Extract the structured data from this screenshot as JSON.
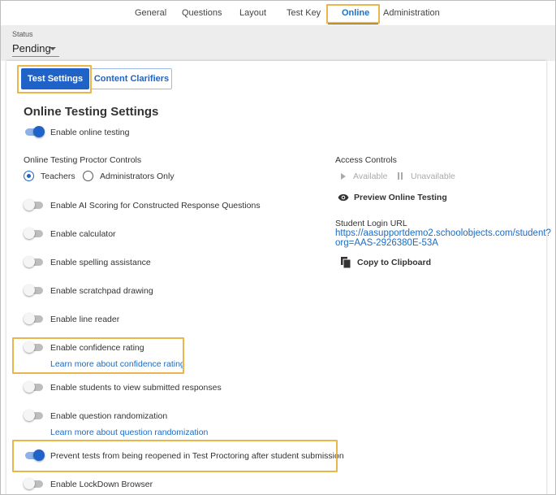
{
  "tabs": [
    {
      "label": "General"
    },
    {
      "label": "Questions"
    },
    {
      "label": "Layout"
    },
    {
      "label": "Test Key"
    },
    {
      "label": "Online"
    },
    {
      "label": "Administration"
    }
  ],
  "status": {
    "label": "Status",
    "value": "Pending"
  },
  "subtabs": {
    "test_settings": "Test Settings",
    "content_clarifiers": "Content Clarifiers"
  },
  "section_title": "Online Testing Settings",
  "enable_online": {
    "label": "Enable online testing",
    "on": true
  },
  "proctor": {
    "label": "Online Testing Proctor Controls",
    "options": [
      {
        "label": "Teachers",
        "checked": true
      },
      {
        "label": "Administrators Only",
        "checked": false
      }
    ]
  },
  "settings": [
    {
      "label": "Enable AI Scoring for Constructed Response Questions",
      "on": false
    },
    {
      "label": "Enable calculator",
      "on": false
    },
    {
      "label": "Enable spelling assistance",
      "on": false
    },
    {
      "label": "Enable scratchpad drawing",
      "on": false
    },
    {
      "label": "Enable line reader",
      "on": false
    },
    {
      "label": "Enable confidence rating",
      "on": false,
      "link": "Learn more about confidence rating"
    },
    {
      "label": "Enable students to view submitted responses",
      "on": false
    },
    {
      "label": "Enable question randomization",
      "on": false,
      "link": "Learn more about question randomization"
    },
    {
      "label": "Prevent tests from being reopened in Test Proctoring after student submission",
      "on": true
    },
    {
      "label": "Enable LockDown Browser",
      "on": false
    }
  ],
  "access": {
    "label": "Access Controls",
    "available": "Available",
    "unavailable": "Unavailable",
    "preview": "Preview Online Testing"
  },
  "login": {
    "label": "Student Login URL",
    "url_line1": "https://aasupportdemo2.schoolobjects.com/student?",
    "url_line2": "org=AAS-2926380E-53A",
    "copy": "Copy to Clipboard"
  },
  "colors": {
    "accent": "#1f63c9",
    "highlight": "#e8b64c",
    "link": "#1a6bc4"
  }
}
